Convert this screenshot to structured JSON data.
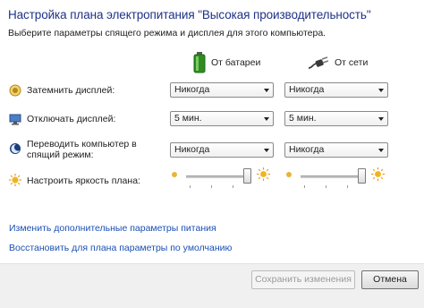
{
  "header": {
    "title": "Настройка плана электропитания \"Высокая производительность\"",
    "subtitle": "Выберите параметры спящего режима и дисплея для этого компьютера."
  },
  "columns": {
    "battery": {
      "label": "От батареи",
      "icon": "battery-icon",
      "color": "#3aa02a"
    },
    "plugged": {
      "label": "От сети",
      "icon": "power-plug-icon"
    }
  },
  "rows": [
    {
      "label": "Затемнить дисплей:",
      "icon": "dim-sun-icon",
      "battery": "Никогда",
      "plugged": "Никогда"
    },
    {
      "label": "Отключать дисплей:",
      "icon": "monitor-icon",
      "battery": "5 мин.",
      "plugged": "5 мин."
    },
    {
      "label": "Переводить компьютер в спящий режим:",
      "icon": "sleep-moon-icon",
      "battery": "Никогда",
      "plugged": "Никогда"
    }
  ],
  "brightness": {
    "label": "Настроить яркость плана:",
    "icon": "brightness-sun-icon",
    "battery_level": 1.0,
    "plugged_level": 1.0
  },
  "links": {
    "advanced": "Изменить дополнительные параметры питания",
    "restore": "Восстановить для плана параметры по умолчанию"
  },
  "buttons": {
    "save": "Сохранить изменения",
    "cancel": "Отмена"
  },
  "colors": {
    "title": "#1e3287",
    "link": "#1a50b4"
  }
}
